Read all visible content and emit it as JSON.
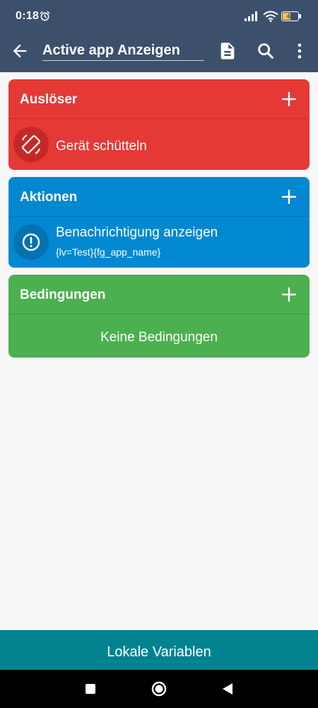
{
  "status_bar": {
    "time": "0:18",
    "battery_level": "43",
    "icons": [
      "alarm-icon",
      "signal-icon",
      "wifi-icon",
      "battery-icon"
    ]
  },
  "toolbar": {
    "title": "Active app Anzeigen",
    "icons": [
      "back-arrow-icon",
      "document-icon",
      "search-icon",
      "more-vert-icon"
    ]
  },
  "triggers": {
    "header": "Auslöser",
    "items": [
      {
        "label": "Gerät schütteln",
        "icon": "screen-rotation-icon"
      }
    ]
  },
  "actions": {
    "header": "Aktionen",
    "items": [
      {
        "label": "Benachrichtigung anzeigen",
        "detail": "{lv=Test}{fg_app_name}",
        "icon": "alert-circle-icon"
      }
    ]
  },
  "conditions": {
    "header": "Bedingungen",
    "empty_label": "Keine Bedingungen"
  },
  "bottom_button": {
    "label": "Lokale Variablen"
  },
  "colors": {
    "appbar": "#3d506b",
    "triggers": "#e53935",
    "actions": "#0288d1",
    "conditions": "#4caf50",
    "bottom_button": "#00838f"
  }
}
